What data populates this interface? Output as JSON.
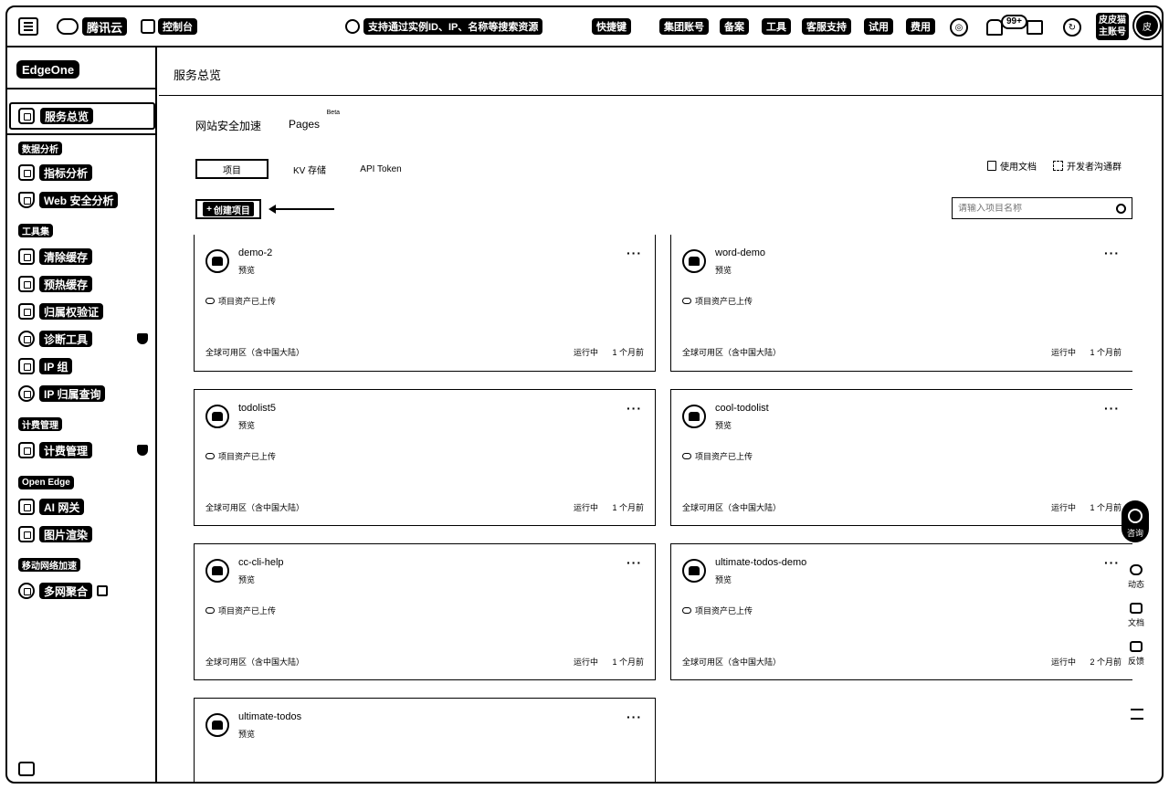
{
  "topbar": {
    "logo": "腾讯云",
    "console": "控制台",
    "search_placeholder": "支持通过实例ID、IP、名称等搜索资源",
    "links": [
      "快捷键",
      "集团账号",
      "备案",
      "工具",
      "客服支持",
      "试用",
      "费用"
    ],
    "notification_badge": "99+",
    "account_line1": "皮皮猫",
    "account_line2": "主账号",
    "avatar_text": "皮"
  },
  "sidebar": {
    "product": "EdgeOne",
    "active_item": "服务总览",
    "sections": [
      {
        "title": "数据分析",
        "items": [
          "指标分析",
          "Web 安全分析"
        ]
      },
      {
        "title": "工具集",
        "items": [
          "清除缓存",
          "预热缓存",
          "归属权验证",
          "诊断工具",
          "IP 组",
          "IP 归属查询"
        ]
      },
      {
        "title": "计费管理",
        "items": [
          "计费管理"
        ]
      },
      {
        "title": "Open Edge",
        "items": [
          "AI 网关",
          "图片渲染"
        ]
      },
      {
        "title": "移动网络加速",
        "items": [
          "多网聚合"
        ]
      }
    ]
  },
  "main": {
    "title": "服务总览",
    "tabs": [
      "网站安全加速",
      "Pages"
    ],
    "tab_badge": "Beta",
    "sub_tabs": [
      "项目",
      "KV 存储",
      "API Token"
    ],
    "links": [
      "使用文档",
      "开发者沟通群"
    ],
    "create_button": "创建项目",
    "search_placeholder": "请输入项目名称"
  },
  "projects": [
    {
      "name": "demo-2",
      "tag": "预览",
      "upload": "项目资产已上传",
      "region": "全球可用区（含中国大陆）",
      "status": "运行中",
      "time": "1 个月前"
    },
    {
      "name": "word-demo",
      "tag": "预览",
      "upload": "项目资产已上传",
      "region": "全球可用区（含中国大陆）",
      "status": "运行中",
      "time": "1 个月前"
    },
    {
      "name": "todolist5",
      "tag": "预览",
      "upload": "项目资产已上传",
      "region": "全球可用区（含中国大陆）",
      "status": "运行中",
      "time": "1 个月前"
    },
    {
      "name": "cool-todolist",
      "tag": "预览",
      "upload": "项目资产已上传",
      "region": "全球可用区（含中国大陆）",
      "status": "运行中",
      "time": "1 个月前"
    },
    {
      "name": "cc-cli-help",
      "tag": "预览",
      "upload": "项目资产已上传",
      "region": "全球可用区（含中国大陆）",
      "status": "运行中",
      "time": "1 个月前"
    },
    {
      "name": "ultimate-todos-demo",
      "tag": "预览",
      "upload": "项目资产已上传",
      "region": "全球可用区（含中国大陆）",
      "status": "运行中",
      "time": "2 个月前"
    },
    {
      "name": "ultimate-todos",
      "tag": "预览"
    }
  ],
  "float": {
    "consult": "咨询",
    "items": [
      "动态",
      "文档",
      "反馈"
    ]
  }
}
